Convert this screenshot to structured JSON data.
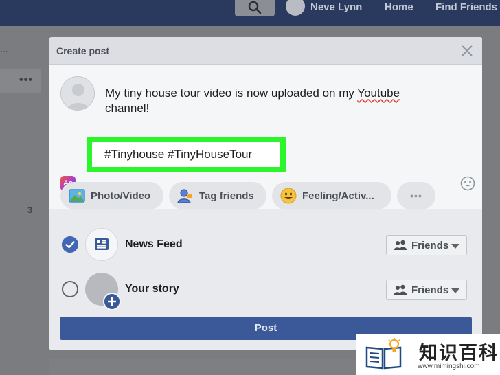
{
  "topbar": {
    "profile_name": "Neve Lynn",
    "home": "Home",
    "find_friends": "Find Friends"
  },
  "background": {
    "ellipsis": "...",
    "more_dots": "•••",
    "count": "3"
  },
  "modal": {
    "title": "Create post",
    "post_line1_prefix": "My tiny house tour video is now uploaded on my ",
    "post_line1_link": "Youtube",
    "post_line2": "channel!",
    "hashtag1": "#Tinyhouse",
    "hashtag2": "#TinyHouseTour",
    "format_label": "Aa",
    "actions": {
      "photo_video": "Photo/Video",
      "tag_friends": "Tag friends",
      "feeling": "Feeling/Activ...",
      "more": "•••"
    },
    "share": {
      "news_feed": "News Feed",
      "your_story": "Your story",
      "audience": "Friends"
    },
    "post_button": "Post"
  },
  "watermark": {
    "title": "知识百科",
    "url": "www.mimingshi.com"
  },
  "colors": {
    "highlight": "#2cf52c",
    "post_button": "#3b5998",
    "check_on": "#4267b2"
  }
}
